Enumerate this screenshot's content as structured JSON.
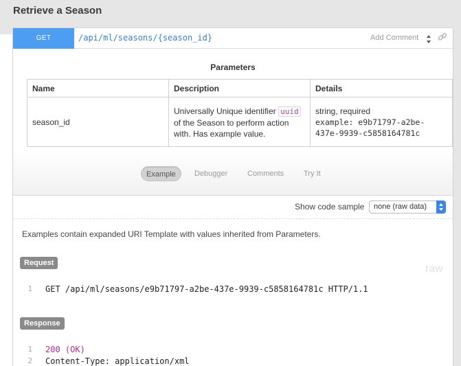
{
  "section": {
    "title": "Retrieve a Season"
  },
  "endpoint": {
    "method": "GET",
    "uri": "/api/ml/seasons/{season_id}",
    "add_comment": "Add Comment"
  },
  "parameters": {
    "title": "Parameters",
    "headers": [
      "Name",
      "Description",
      "Details"
    ],
    "rows": [
      {
        "name": "season_id",
        "desc_before": "Universally Unique identifier",
        "desc_code": "uuid",
        "desc_after": "of the Season to perform action with. Has example value.",
        "details_type": "string, required",
        "details_example": "example: e9b71797-a2be-437e-9939-c5858164781c"
      }
    ]
  },
  "tabs": [
    {
      "label": "Example",
      "active": true
    },
    {
      "label": "Debugger",
      "active": false
    },
    {
      "label": "Comments",
      "active": false
    },
    {
      "label": "Try It",
      "active": false
    }
  ],
  "code_sample": {
    "label": "Show code sample",
    "selected": "none (raw data)"
  },
  "examples_note": "Examples contain expanded URI Template with values inherited from Parameters.",
  "request": {
    "label": "Request",
    "raw_label": "raw",
    "lines": [
      {
        "n": "1",
        "text": "GET /api/ml/seasons/e9b71797-a2be-437e-9939-c5858164781c HTTP/1.1"
      }
    ]
  },
  "response": {
    "label": "Response",
    "lines": [
      {
        "n": "1",
        "text": "200 (OK)"
      },
      {
        "n": "2",
        "text": "Content-Type: application/xml"
      }
    ]
  },
  "colors": {
    "method_badge": "#4d9ef2",
    "uri": "#3c7fc0",
    "select_arrow": "#3a86e8"
  }
}
